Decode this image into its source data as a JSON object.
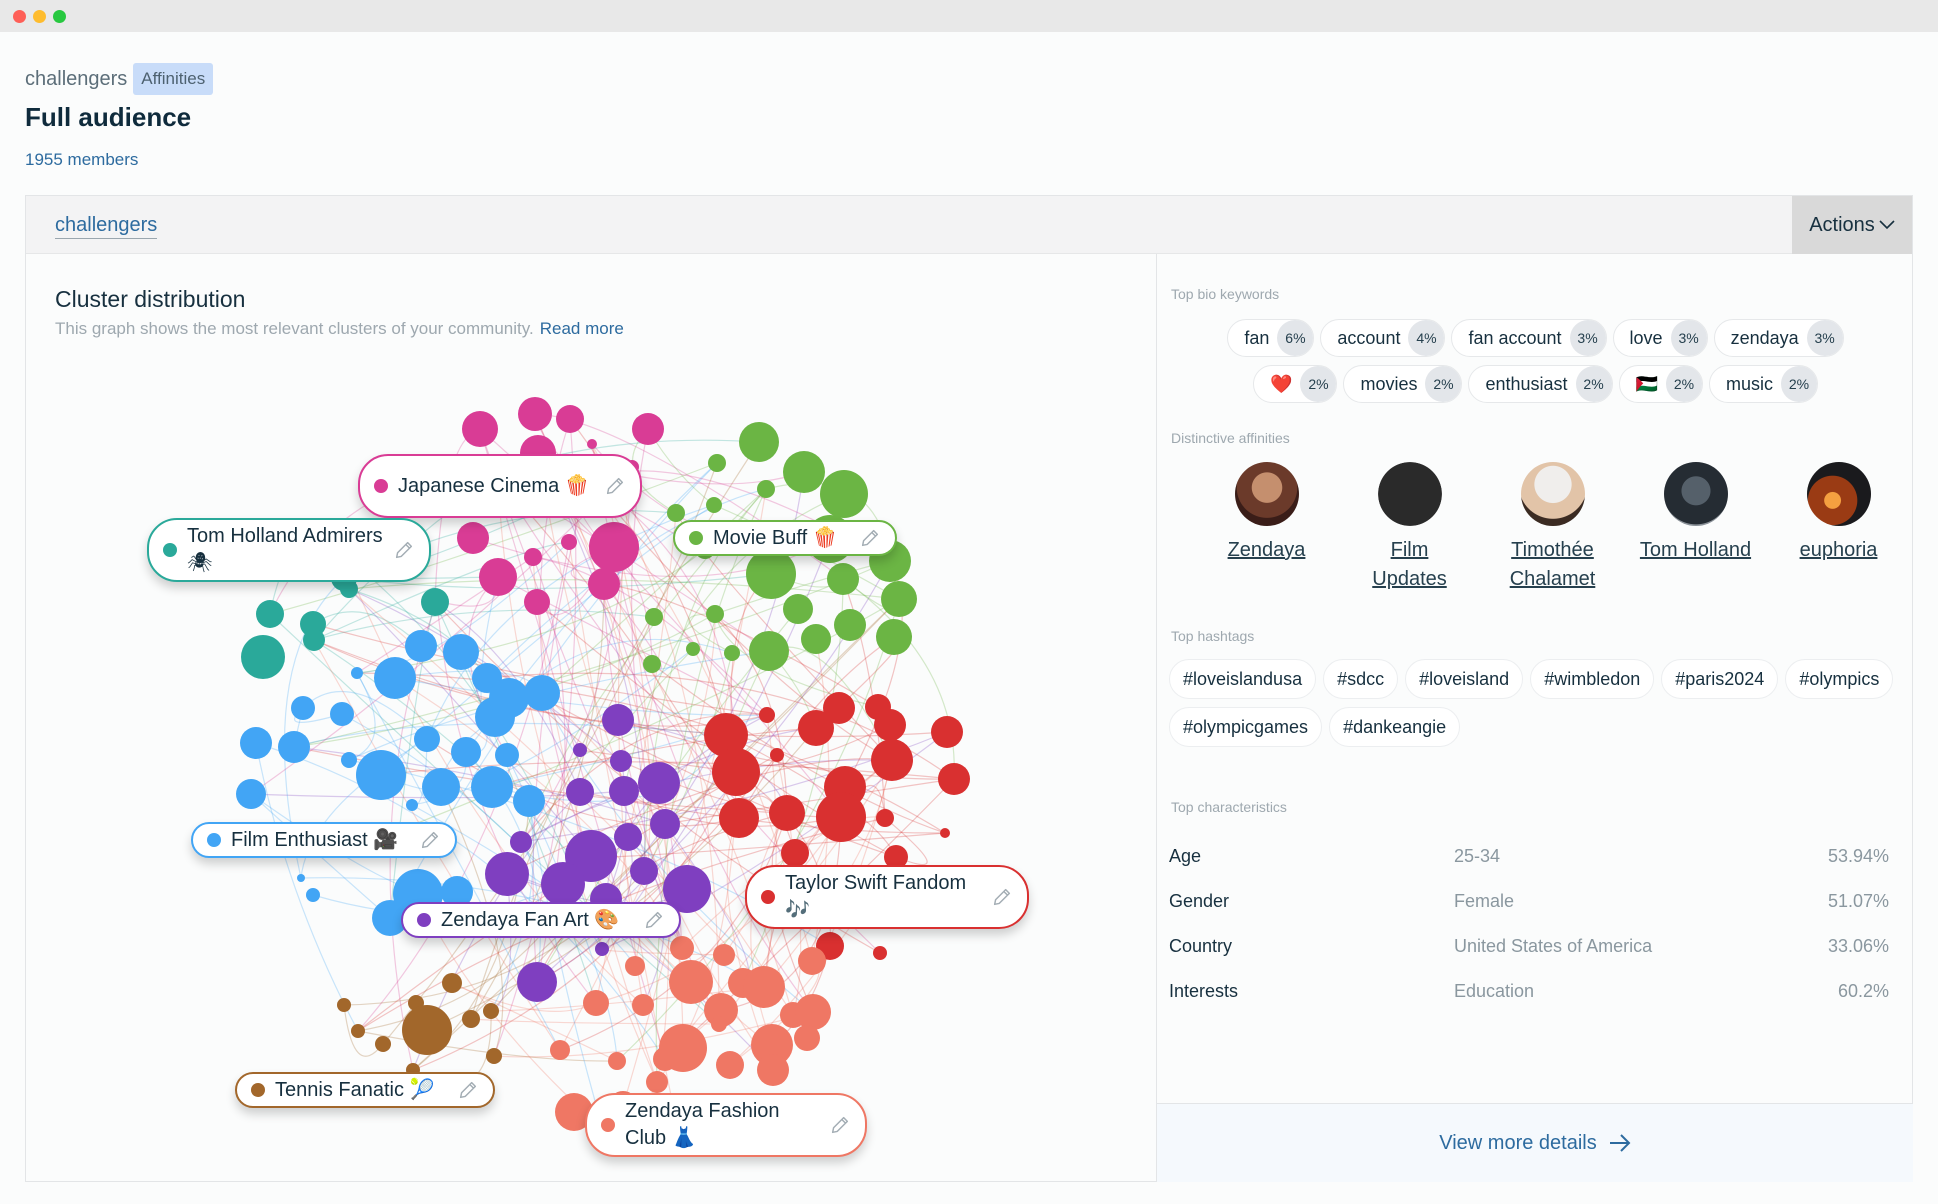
{
  "window": {
    "controls": [
      "close",
      "minimize",
      "maximize"
    ]
  },
  "breadcrumb": {
    "project": "challengers",
    "badge": "Affinities"
  },
  "header": {
    "title": "Full audience",
    "members": "1955 members"
  },
  "card": {
    "tab": "challengers",
    "actions_label": "Actions",
    "actions_icon": "chevron-down-icon"
  },
  "cluster": {
    "title": "Cluster distribution",
    "subtitle": "This graph shows the most relevant clusters of your community.",
    "read_more": "Read more",
    "clusters": [
      {
        "name": "Japanese Cinema 🍿",
        "color": "#d93c95"
      },
      {
        "name": "Tom Holland Admirers 🕷",
        "color": "#2aa99a"
      },
      {
        "name": "Movie Buff 🍿",
        "color": "#6bb544"
      },
      {
        "name": "Film Enthusiast 🎥",
        "color": "#42a5f5"
      },
      {
        "name": "Zendaya Fan Art 🎨",
        "color": "#7f3fc0"
      },
      {
        "name": "Taylor Swift Fandom 🎶",
        "color": "#d93030"
      },
      {
        "name": "Tennis Fanatic 🎾",
        "color": "#a2672b"
      },
      {
        "name": "Zendaya Fashion Club 👗",
        "color": "#ef7764"
      }
    ]
  },
  "panel": {
    "bio_keywords_label": "Top bio keywords",
    "bio_keywords": [
      [
        {
          "word": "fan",
          "pct": "6%"
        },
        {
          "word": "account",
          "pct": "4%"
        },
        {
          "word": "fan account",
          "pct": "3%"
        },
        {
          "word": "love",
          "pct": "3%"
        },
        {
          "word": "zendaya",
          "pct": "3%"
        }
      ],
      [
        {
          "word": "❤️",
          "pct": "2%"
        },
        {
          "word": "movies",
          "pct": "2%"
        },
        {
          "word": "enthusiast",
          "pct": "2%"
        },
        {
          "word": "🇵🇸",
          "pct": "2%"
        },
        {
          "word": "music",
          "pct": "2%"
        }
      ]
    ],
    "affinities_label": "Distinctive affinities",
    "affinities": [
      {
        "name": "Zendaya",
        "avatar": "zendaya-avatar"
      },
      {
        "name": "Film Updates",
        "avatar": "film-updates-avatar"
      },
      {
        "name": "Timothée Chalamet",
        "avatar": "timothee-chalamet-avatar"
      },
      {
        "name": "Tom Holland",
        "avatar": "tom-holland-avatar"
      },
      {
        "name": "euphoria",
        "avatar": "euphoria-avatar"
      }
    ],
    "hashtags_label": "Top hashtags",
    "hashtags": [
      "#loveislandusa",
      "#sdcc",
      "#loveisland",
      "#wimbledon",
      "#paris2024",
      "#olympics",
      "#olympicgames",
      "#dankeangie"
    ],
    "characteristics_label": "Top characteristics",
    "characteristics": [
      {
        "key": "Age",
        "value": "25-34",
        "pct": "53.94%"
      },
      {
        "key": "Gender",
        "value": "Female",
        "pct": "51.07%"
      },
      {
        "key": "Country",
        "value": "United States of America",
        "pct": "33.06%"
      },
      {
        "key": "Interests",
        "value": "Education",
        "pct": "60.2%"
      }
    ],
    "view_more": "View more details"
  }
}
